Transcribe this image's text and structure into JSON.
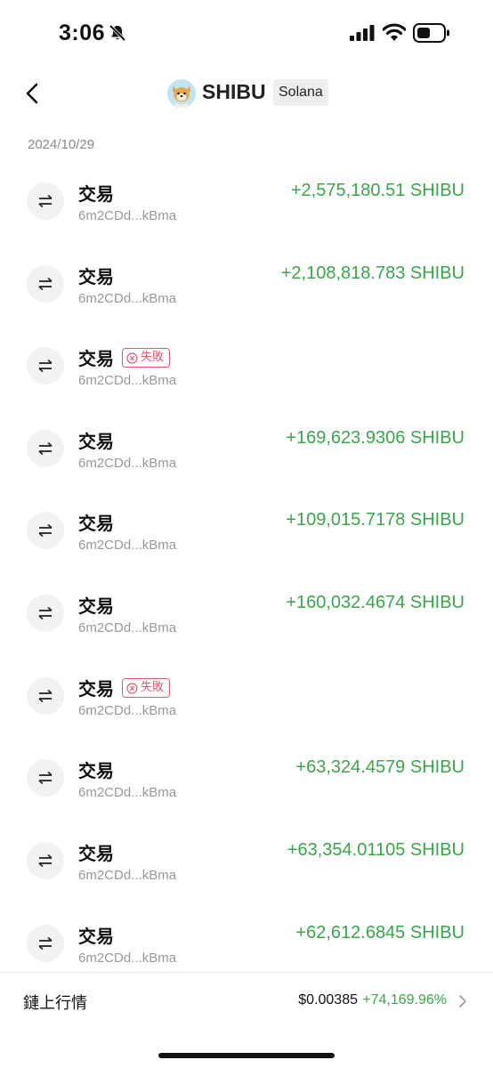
{
  "status_bar": {
    "time": "3:06"
  },
  "header": {
    "token_name": "SHIBU",
    "chain": "Solana"
  },
  "date": "2024/10/29",
  "transactions": [
    {
      "type": "交易",
      "address": "6m2CDd...kBma",
      "amount": "+2,575,180.51 SHIBU"
    },
    {
      "type": "交易",
      "address": "6m2CDd...kBma",
      "amount": "+2,108,818.783 SHIBU"
    },
    {
      "type": "交易",
      "address": "6m2CDd...kBma",
      "status": "失敗"
    },
    {
      "type": "交易",
      "address": "6m2CDd...kBma",
      "amount": "+169,623.9306 SHIBU"
    },
    {
      "type": "交易",
      "address": "6m2CDd...kBma",
      "amount": "+109,015.7178 SHIBU"
    },
    {
      "type": "交易",
      "address": "6m2CDd...kBma",
      "amount": "+160,032.4674 SHIBU"
    },
    {
      "type": "交易",
      "address": "6m2CDd...kBma",
      "status": "失敗"
    },
    {
      "type": "交易",
      "address": "6m2CDd...kBma",
      "amount": "+63,324.4579 SHIBU"
    },
    {
      "type": "交易",
      "address": "6m2CDd...kBma",
      "amount": "+63,354.01105 SHIBU"
    },
    {
      "type": "交易",
      "address": "6m2CDd...kBma",
      "amount": "+62,612.6845 SHIBU"
    }
  ],
  "market": {
    "label": "鏈上行情",
    "price": "$0.00385",
    "change": "+74,169.96%"
  },
  "colors": {
    "positive": "#3aa64a",
    "failed": "#e35a75"
  },
  "icons": {
    "tx": "swap-arrows-icon",
    "failed": "x-circle-icon"
  }
}
